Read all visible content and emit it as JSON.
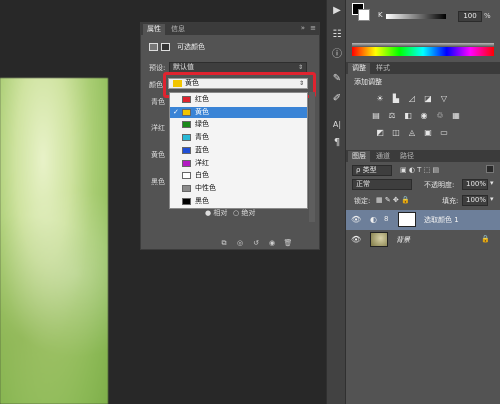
{
  "canvas": {
    "photo": "blurred-green-photo"
  },
  "properties": {
    "tabs": [
      "属性",
      "信息"
    ],
    "title": "可选颜色",
    "preset_label": "预设:",
    "preset_value": "默认值",
    "color_label": "颜色:",
    "color_value": "黄色",
    "side_labels": [
      "青色",
      "洋红",
      "黄色",
      "黑色"
    ],
    "method_options": [
      "相对",
      "绝对"
    ],
    "dropdown": [
      {
        "label": "红色",
        "color": "#e0232f",
        "selected": false
      },
      {
        "label": "黄色",
        "color": "#f2c500",
        "selected": true
      },
      {
        "label": "绿色",
        "color": "#1a8a1a",
        "selected": false
      },
      {
        "label": "青色",
        "color": "#29b9d6",
        "selected": false
      },
      {
        "label": "蓝色",
        "color": "#1f4fd6",
        "selected": false
      },
      {
        "label": "洋红",
        "color": "#b21ac2",
        "selected": false
      },
      {
        "label": "白色",
        "color": "#ffffff",
        "selected": false
      },
      {
        "label": "中性色",
        "color": "#8a8a8a",
        "selected": false
      },
      {
        "label": "黑色",
        "color": "#000000",
        "selected": false
      }
    ]
  },
  "color_panel": {
    "k_value": "100"
  },
  "adjustments": {
    "tabs": [
      "调整",
      "样式"
    ],
    "title": "添加调整"
  },
  "layers": {
    "tabs": [
      "图层",
      "通道",
      "路径"
    ],
    "kind_value": "类型",
    "blend_mode": "正常",
    "opacity_label": "不透明度:",
    "opacity_value": "100%",
    "lock_label": "锁定:",
    "fill_label": "填充:",
    "fill_value": "100%",
    "rows": [
      {
        "name": "选取颜色 1",
        "selected": true
      },
      {
        "name": "背景",
        "selected": false
      }
    ]
  }
}
